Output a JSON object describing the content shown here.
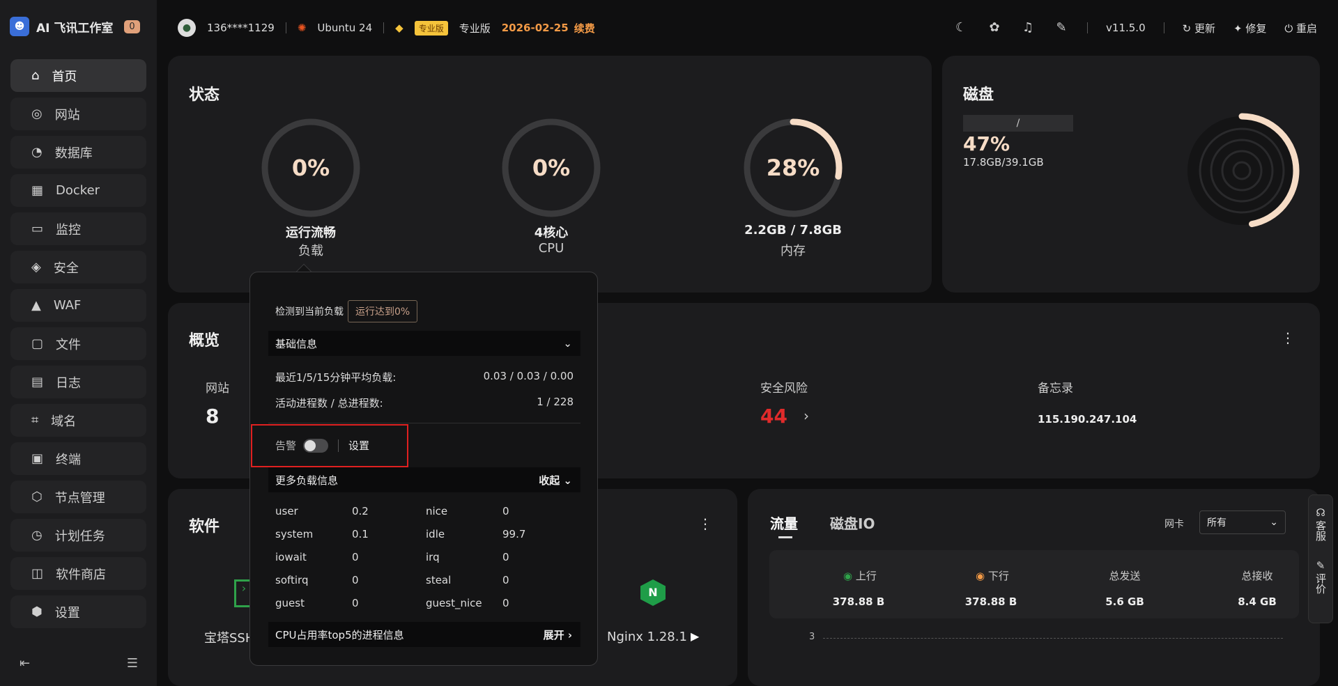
{
  "app": {
    "title": "AI 飞讯工作室",
    "badge": "0"
  },
  "sidebar": {
    "items": [
      {
        "label": "首页",
        "icon": "home-icon"
      },
      {
        "label": "网站",
        "icon": "globe-icon"
      },
      {
        "label": "数据库",
        "icon": "database-icon"
      },
      {
        "label": "Docker",
        "icon": "docker-icon"
      },
      {
        "label": "监控",
        "icon": "monitor-icon"
      },
      {
        "label": "安全",
        "icon": "shield-icon"
      },
      {
        "label": "WAF",
        "icon": "waf-icon"
      },
      {
        "label": "文件",
        "icon": "folder-icon"
      },
      {
        "label": "日志",
        "icon": "log-icon"
      },
      {
        "label": "域名",
        "icon": "domain-icon"
      },
      {
        "label": "终端",
        "icon": "terminal-icon"
      },
      {
        "label": "节点管理",
        "icon": "node-icon"
      },
      {
        "label": "计划任务",
        "icon": "clock-icon"
      },
      {
        "label": "软件商店",
        "icon": "store-icon"
      },
      {
        "label": "设置",
        "icon": "gear-icon"
      }
    ]
  },
  "topbar": {
    "user": "136****1129",
    "os": "Ubuntu 24",
    "pro_tag": "专业版",
    "pro_label": "专业版",
    "expire": "2026-02-25",
    "renew": "续费",
    "version": "v11.5.0",
    "update": "更新",
    "repair": "修复",
    "restart": "重启"
  },
  "status": {
    "title": "状态",
    "gauges": [
      {
        "value": "0%",
        "label": "运行流畅",
        "sub": "负载",
        "percent": 0
      },
      {
        "value": "0%",
        "label": "4核心",
        "sub": "CPU",
        "percent": 0
      },
      {
        "value": "28%",
        "label": "2.2GB / 7.8GB",
        "sub": "内存",
        "percent": 28
      }
    ]
  },
  "disk": {
    "title": "磁盘",
    "path": "/",
    "percent": "47%",
    "usage": "17.8GB/39.1GB",
    "percent_value": 47
  },
  "popup": {
    "head": "检测到当前负载",
    "tag": "运行达到0%",
    "basic": "基础信息",
    "avg_label": "最近1/5/15分钟平均负载:",
    "avg_value": "0.03 / 0.03 / 0.00",
    "proc_label": "活动进程数 / 总进程数:",
    "proc_value": "1 / 228",
    "alarm": "告警",
    "settings": "设置",
    "more": "更多负载信息",
    "collapse": "收起",
    "grid": [
      [
        "user",
        "0.2",
        "nice",
        "0"
      ],
      [
        "system",
        "0.1",
        "idle",
        "99.7"
      ],
      [
        "iowait",
        "0",
        "irq",
        "0"
      ],
      [
        "softirq",
        "0",
        "steal",
        "0"
      ],
      [
        "guest",
        "0",
        "guest_nice",
        "0"
      ]
    ],
    "top5": "CPU占用率top5的进程信息",
    "expand": "展开"
  },
  "overview": {
    "title": "概览",
    "website_label": "网站",
    "website_value": "8",
    "risk_label": "安全风险",
    "risk_value": "44",
    "memo_label": "备忘录",
    "memo_value": "115.190.247.104"
  },
  "software": {
    "title": "软件",
    "items": [
      {
        "label": "宝塔SSH"
      },
      {
        "label": "Nginx 1.28.1"
      }
    ]
  },
  "traffic": {
    "tab_flow": "流量",
    "tab_io": "磁盘IO",
    "nic_label": "网卡",
    "nic_value": "所有",
    "up": "上行",
    "down": "下行",
    "sent": "总发送",
    "recv": "总接收",
    "up_val": "378.88 B",
    "down_val": "378.88 B",
    "sent_val": "5.6 GB",
    "recv_val": "8.4 GB",
    "axis": "3"
  },
  "side_tabs": {
    "service": "客服",
    "review": "评价"
  }
}
